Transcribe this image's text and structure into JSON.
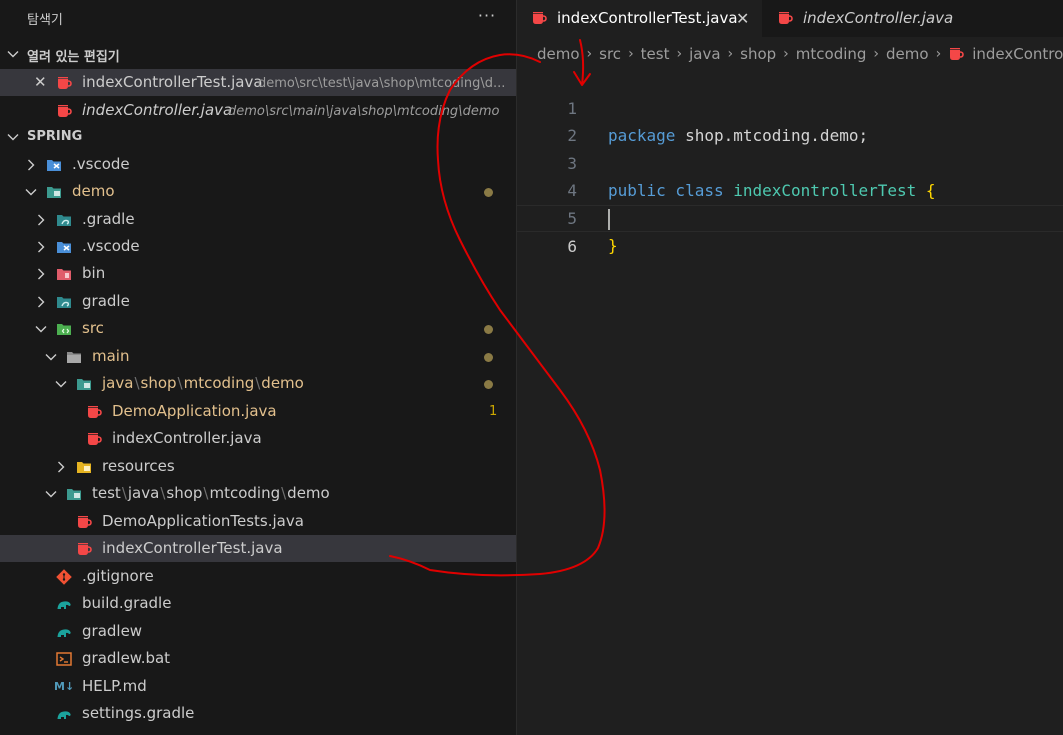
{
  "sidebar": {
    "title": "탐색기",
    "more_actions": "···",
    "open_editors": {
      "label": "열려 있는 편집기",
      "items": [
        {
          "name": "indexControllerTest.java",
          "path": "demo\\src\\test\\java\\shop\\mtcoding\\d...",
          "close": "✕"
        },
        {
          "name": "indexController.java",
          "path": "demo\\src\\main\\java\\shop\\mtcoding\\demo"
        }
      ]
    },
    "workspace": {
      "label": "SPRING",
      "items": [
        {
          "label": ".vscode",
          "icon": "vscode-folder-icon"
        },
        {
          "label": "demo",
          "icon": "project-folder-icon"
        },
        {
          "label": ".gradle",
          "icon": "gradle-folder-icon"
        },
        {
          "label": ".vscode",
          "icon": "vscode-folder-icon"
        },
        {
          "label": "bin",
          "icon": "bin-folder-icon"
        },
        {
          "label": "gradle",
          "icon": "gradle-folder-icon"
        },
        {
          "label": "src",
          "icon": "src-folder-icon"
        },
        {
          "label": "main",
          "icon": "folder-icon"
        },
        {
          "parts": [
            "java",
            "shop",
            "mtcoding",
            "demo"
          ],
          "icon": "package-folder-icon"
        },
        {
          "label": "DemoApplication.java",
          "icon": "java-icon",
          "badge": "1"
        },
        {
          "label": "indexController.java",
          "icon": "java-icon"
        },
        {
          "label": "resources",
          "icon": "resources-folder-icon"
        },
        {
          "parts": [
            "test",
            "java",
            "shop",
            "mtcoding",
            "demo"
          ],
          "icon": "package-folder-icon"
        },
        {
          "label": "DemoApplicationTests.java",
          "icon": "java-icon"
        },
        {
          "label": "indexControllerTest.java",
          "icon": "java-icon"
        },
        {
          "label": ".gitignore",
          "icon": "git-icon"
        },
        {
          "label": "build.gradle",
          "icon": "gradle-icon"
        },
        {
          "label": "gradlew",
          "icon": "gradle-icon"
        },
        {
          "label": "gradlew.bat",
          "icon": "terminal-icon"
        },
        {
          "label": "HELP.md",
          "icon": "markdown-icon",
          "icon_text": "M↓"
        },
        {
          "label": "settings.gradle",
          "icon": "gradle-icon"
        }
      ]
    }
  },
  "tabs": [
    {
      "label": "indexControllerTest.java",
      "close": "✕"
    },
    {
      "label": "indexController.java"
    }
  ],
  "breadcrumb": [
    "demo",
    "src",
    "test",
    "java",
    "shop",
    "mtcoding",
    "demo",
    "indexControll"
  ],
  "code": {
    "line_numbers": [
      "1",
      "2",
      "3",
      "4",
      "5",
      "6"
    ],
    "l1_kw": "package",
    "l1_rest": " shop.mtcoding.demo;",
    "l3_kw1": "public",
    "l3_kw2": " class ",
    "l3_cls": "indexControllerTest",
    "l3_brace": " {",
    "l5_brace": "}"
  },
  "colors": {
    "accent": "#0078d4",
    "java_icon": "#f44747",
    "modified": "#e2c08d",
    "annotation": "#e00000"
  }
}
